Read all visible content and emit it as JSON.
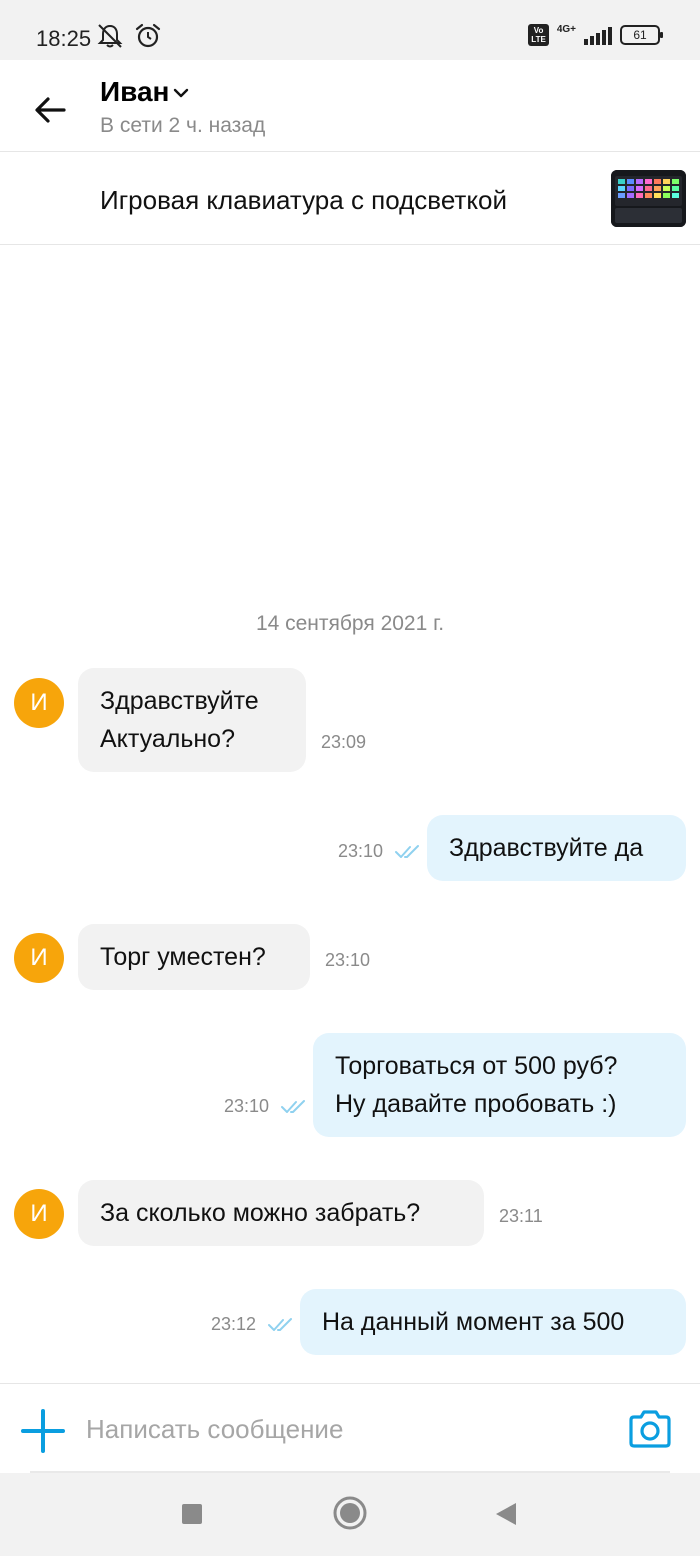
{
  "status_bar": {
    "time": "18:25",
    "network": "4G+",
    "volte": "Vo LTE",
    "battery": "61"
  },
  "header": {
    "contact_name": "Иван",
    "contact_status": "В сети 2 ч. назад"
  },
  "ad": {
    "title": "Игровая клавиатура с подсветкой"
  },
  "chat": {
    "date": "14 сентября 2021 г.",
    "avatar_letter": "И",
    "messages": [
      {
        "direction": "in",
        "text": "Здравствуйте\nАктуально?",
        "time": "23:09"
      },
      {
        "direction": "out",
        "text": "Здравствуйте да",
        "time": "23:10",
        "read": true
      },
      {
        "direction": "in",
        "text": "Торг уместен?",
        "time": "23:10"
      },
      {
        "direction": "out",
        "text": "Торговаться от 500 руб?\nНу давайте пробовать :)",
        "time": "23:10",
        "read": true
      },
      {
        "direction": "in",
        "text": "За сколько можно забрать?",
        "time": "23:11"
      },
      {
        "direction": "out",
        "text": "На данный момент за 500",
        "time": "23:12",
        "read": true
      }
    ]
  },
  "composer": {
    "placeholder": "Написать сообщение"
  },
  "colors": {
    "accent": "#0a9ee0",
    "avatar": "#f7a50b",
    "incoming_bubble": "#f2f2f2",
    "outgoing_bubble": "#e3f4fd"
  }
}
